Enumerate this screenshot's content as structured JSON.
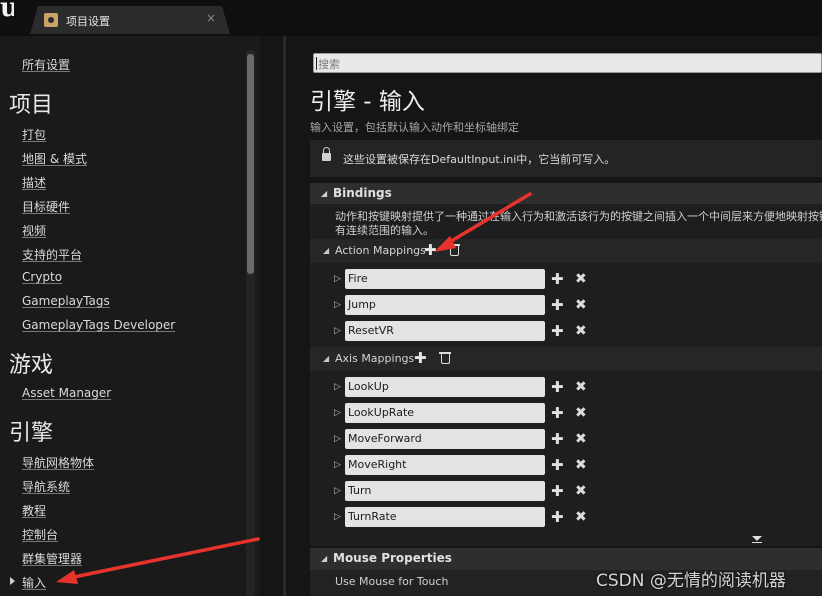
{
  "tab": {
    "title": "项目设置",
    "close": "×"
  },
  "sidebar": {
    "all_settings": "所有设置",
    "sections": [
      {
        "header": "项目",
        "items": [
          "打包",
          "地图 & 模式",
          "描述",
          "目标硬件",
          "视频",
          "支持的平台",
          "Crypto",
          "GameplayTags",
          "GameplayTags Developer"
        ]
      },
      {
        "header": "游戏",
        "items": [
          "Asset Manager"
        ]
      },
      {
        "header": "引擎",
        "items": [
          "导航网格物体",
          "导航系统",
          "教程",
          "控制台",
          "群集管理器",
          "输入"
        ]
      }
    ],
    "active_item": "输入"
  },
  "search": {
    "placeholder": "搜索"
  },
  "page": {
    "title": "引擎 - 输入",
    "subtitle": "输入设置，包括默认输入动作和坐标轴绑定"
  },
  "notice": {
    "text": "这些设置被保存在DefaultInput.ini中，它当前可写入。"
  },
  "bindings": {
    "title": "Bindings",
    "description_line1": "动作和按键映射提供了一种通过在输入行为和激活该行为的按键之间插入一个中间层来方便地映射按键",
    "description_line2": "有连续范围的输入。",
    "action_mappings": {
      "title": "Action Mappings",
      "items": [
        "Fire",
        "Jump",
        "ResetVR"
      ]
    },
    "axis_mappings": {
      "title": "Axis Mappings",
      "items": [
        "LookUp",
        "LookUpRate",
        "MoveForward",
        "MoveRight",
        "Turn",
        "TurnRate"
      ]
    }
  },
  "mouse_properties": {
    "title": "Mouse Properties",
    "first_item": "Use Mouse for Touch"
  },
  "icons": {
    "plus": "✚",
    "remove": "✖",
    "caret_right": "▷",
    "caret_down": "◢"
  },
  "watermark": "CSDN @无情的阅读机器",
  "colors": {
    "annotation_arrow": "#e8332c",
    "field_bg": "#e3e3e3",
    "panel_bg": "#151515"
  }
}
